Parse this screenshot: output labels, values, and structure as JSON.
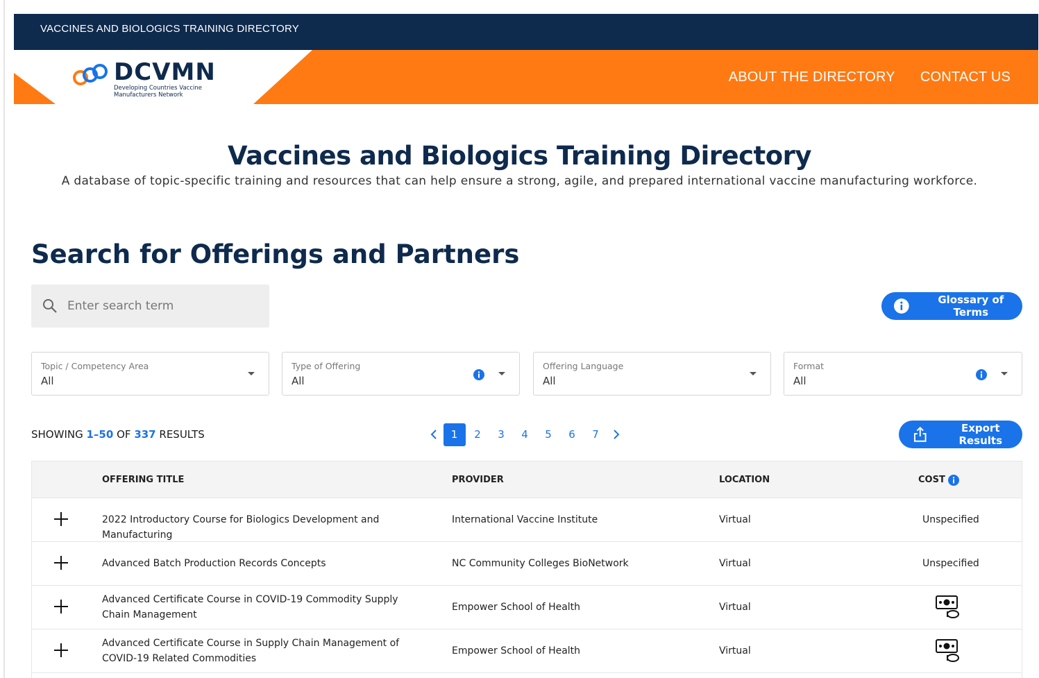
{
  "topbar": {
    "title": "VACCINES AND BIOLOGICS TRAINING DIRECTORY"
  },
  "header": {
    "logo_name": "DCVMN",
    "logo_tagline": "Developing Countries Vaccine Manufacturers Network",
    "nav": [
      "ABOUT THE DIRECTORY",
      "CONTACT US"
    ]
  },
  "hero": {
    "title": "Vaccines and Biologics Training Directory",
    "subtitle": "A database of topic-specific training and resources that can help ensure a strong, agile, and prepared international vaccine manufacturing workforce."
  },
  "search_section": {
    "title": "Search for Offerings and Partners",
    "search_placeholder": "Enter search term",
    "glossary_label": "Glossary of Terms"
  },
  "filters": [
    {
      "label": "Topic / Competency Area",
      "value": "All"
    },
    {
      "label": "Type of Offering",
      "value": "All"
    },
    {
      "label": "Offering Language",
      "value": "All"
    },
    {
      "label": "Format",
      "value": "All"
    }
  ],
  "results": {
    "prefix": "SHOWING",
    "range": "1–50",
    "of_label": "OF",
    "total": "337",
    "suffix": "RESULTS",
    "pages": [
      "1",
      "2",
      "3",
      "4",
      "5",
      "6",
      "7"
    ],
    "current_page": "1",
    "export_label": "Export Results"
  },
  "table": {
    "columns": [
      "OFFERING TITLE",
      "PROVIDER",
      "LOCATION",
      "COST"
    ],
    "rows": [
      {
        "title": "2022 Introductory Course for Biologics Development and Manufacturing",
        "provider": "International Vaccine Institute",
        "location": "Virtual",
        "cost": "Unspecified"
      },
      {
        "title": "Advanced Batch Production Records Concepts",
        "provider": "NC Community Colleges BioNetwork",
        "location": "Virtual",
        "cost": "Unspecified"
      },
      {
        "title": "Advanced Certificate Course in COVID-19 Commodity Supply Chain Management",
        "provider": "Empower School of Health",
        "location": "Virtual",
        "cost": ""
      },
      {
        "title": "Advanced Certificate Course in Supply Chain Management of COVID-19 Related Commodities",
        "provider": "Empower School of Health",
        "location": "Virtual",
        "cost": ""
      }
    ]
  },
  "colors": {
    "navy": "#0e2a4d",
    "orange": "#ff7a12",
    "accent_blue": "#1a73e8"
  }
}
